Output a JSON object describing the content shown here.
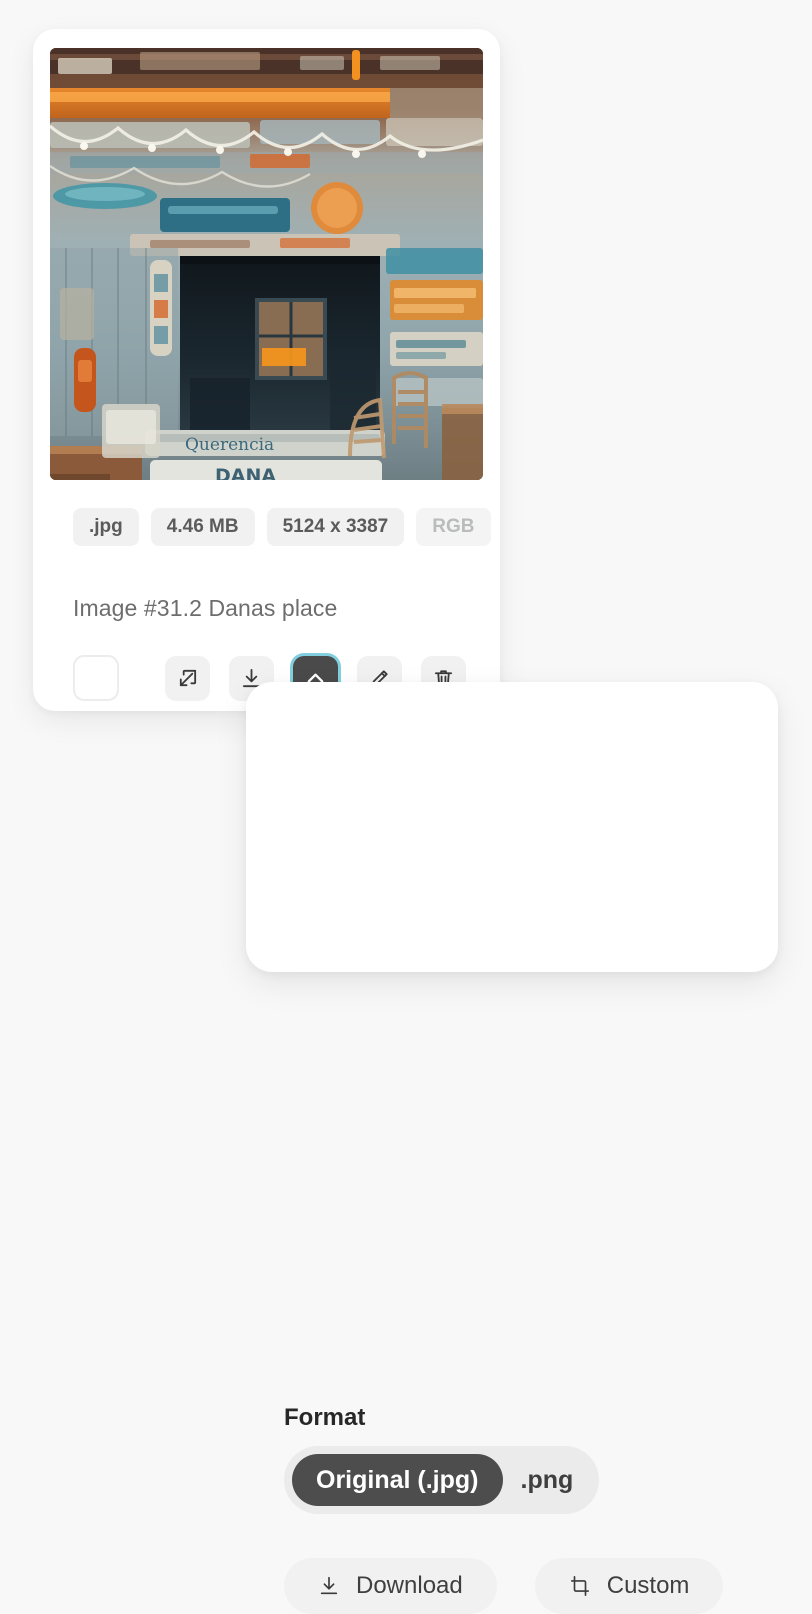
{
  "asset_card": {
    "image": {
      "alt_description": "Rustic beach shack wall covered in weathered painted wooden signs with string lights, teal and orange palette",
      "icon": "photo-thumbnail"
    },
    "metadata": [
      {
        "label": ".jpg",
        "name": "format-badge",
        "faded": false
      },
      {
        "label": "4.46 MB",
        "name": "filesize-badge",
        "faded": false
      },
      {
        "label": "5124 x 3387",
        "name": "dimensions-badge",
        "faded": false
      },
      {
        "label": "RGB",
        "name": "colorspace-badge",
        "faded": true
      }
    ],
    "caption": "Image #31.2 Danas place",
    "toolbar": {
      "select_checkbox": {
        "name": "select-checkbox",
        "checked": false
      },
      "actions": [
        {
          "name": "open-external-icon",
          "label": "Open in new window",
          "active": false
        },
        {
          "name": "download-icon",
          "label": "Download",
          "active": false
        },
        {
          "name": "chevron-up-icon",
          "label": "Show download options",
          "active": true
        },
        {
          "name": "pencil-icon",
          "label": "Edit",
          "active": false
        },
        {
          "name": "trash-icon",
          "label": "Delete",
          "active": false
        }
      ]
    }
  },
  "popover": {
    "title": "Format",
    "format_options": [
      {
        "label": "Original (.jpg)",
        "selected": true
      },
      {
        "label": ".png",
        "selected": false
      }
    ],
    "buttons": [
      {
        "label": "Download",
        "icon": "download-icon"
      },
      {
        "label": "Custom",
        "icon": "crop-icon"
      }
    ]
  },
  "colors": {
    "page_background": "#f8f8f8",
    "card_background": "#ffffff",
    "badge_background": "#f1f1f1",
    "badge_text": "#5b5b5b",
    "badge_faded_text": "#b9bcbb",
    "caption_text": "#6d6d6d",
    "active_button_background": "#4a4a4a",
    "focus_ring": "#82cfe0",
    "segment_track": "#ebebeb",
    "segment_selected": "#4d4d4d"
  }
}
